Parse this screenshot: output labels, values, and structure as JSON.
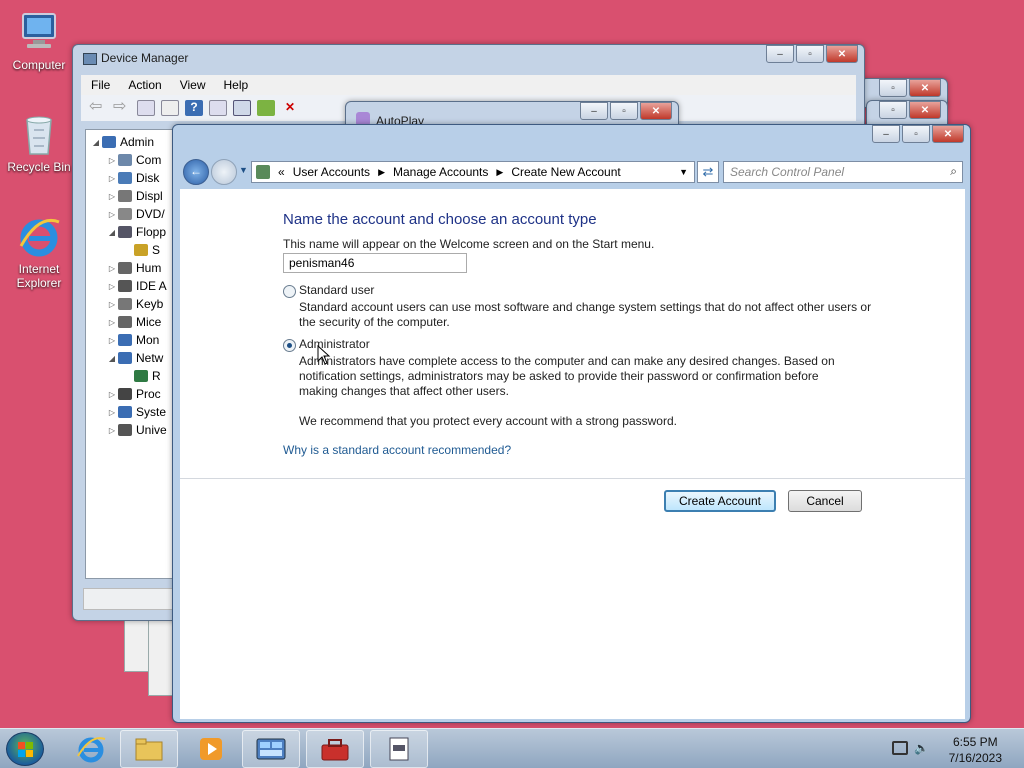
{
  "desktop": {
    "icons": [
      {
        "label": "Computer",
        "icon": "computer-icon"
      },
      {
        "label": "Recycle Bin",
        "icon": "recycle-bin-icon"
      },
      {
        "label": "Internet Explorer",
        "icon": "internet-explorer-icon"
      }
    ]
  },
  "device_manager": {
    "title": "Device Manager",
    "menu": [
      "File",
      "Action",
      "View",
      "Help"
    ],
    "tree": [
      {
        "label": "Admin",
        "level": 0,
        "expanded": true
      },
      {
        "label": "Com",
        "level": 1
      },
      {
        "label": "Disk",
        "level": 1
      },
      {
        "label": "Displ",
        "level": 1
      },
      {
        "label": "DVD/",
        "level": 1
      },
      {
        "label": "Flopp",
        "level": 1,
        "expanded": true
      },
      {
        "label": "S",
        "level": 2
      },
      {
        "label": "Hum",
        "level": 1
      },
      {
        "label": "IDE A",
        "level": 1
      },
      {
        "label": "Keyb",
        "level": 1
      },
      {
        "label": "Mice",
        "level": 1
      },
      {
        "label": "Mon",
        "level": 1
      },
      {
        "label": "Netw",
        "level": 1,
        "expanded": true
      },
      {
        "label": "R",
        "level": 2
      },
      {
        "label": "Proc",
        "level": 1
      },
      {
        "label": "Syste",
        "level": 1
      },
      {
        "label": "Unive",
        "level": 1
      }
    ]
  },
  "autoplay": {
    "title": "AutoPlay"
  },
  "control_panel": {
    "breadcrumb": [
      "User Accounts",
      "Manage Accounts",
      "Create New Account"
    ],
    "breadcrumb_prefix": "«",
    "search_placeholder": "Search Control Panel",
    "heading": "Name the account and choose an account type",
    "name_hint": "This name will appear on the Welcome screen and on the Start menu.",
    "account_name": "penisman46",
    "standard": {
      "label": "Standard user",
      "description_line1": "Standard account users can use most software and change system settings that do not affect other users or",
      "description_line2": "the security of the computer.",
      "selected": false
    },
    "administrator": {
      "label": "Administrator",
      "description_line1": "Administrators have complete access to the computer and can make any desired changes. Based on",
      "description_line2": "notification settings, administrators may be asked to provide their password or confirmation before",
      "description_line3": "making changes that affect other users.",
      "selected": true
    },
    "recommendation": "We recommend that you protect every account with a strong password.",
    "help_link": "Why is a standard account recommended?",
    "create_button": "Create Account",
    "cancel_button": "Cancel"
  },
  "taskbar": {
    "time": "6:55 PM",
    "date": "7/16/2023"
  },
  "colors": {
    "desktop": "#d9506f",
    "heading": "#1e3287",
    "link": "#1f5a92"
  }
}
